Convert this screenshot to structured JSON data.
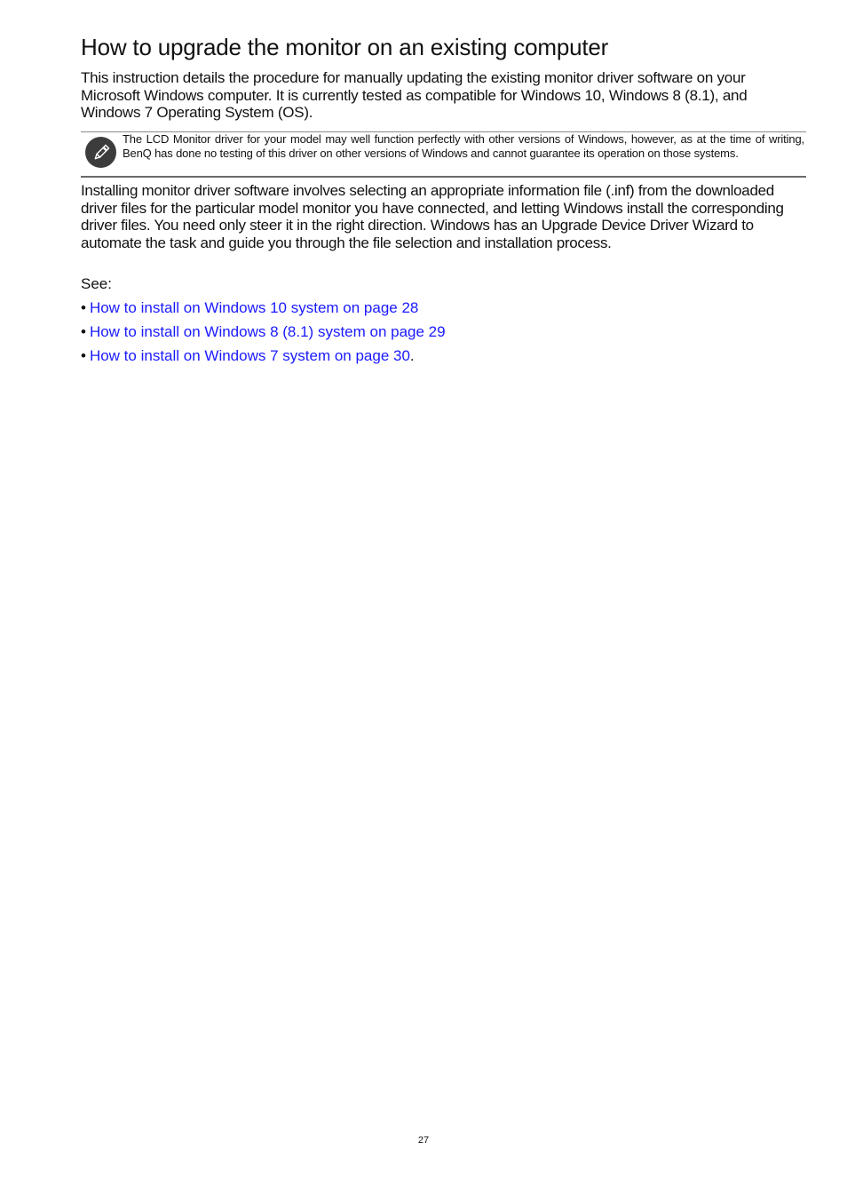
{
  "document": {
    "title": "How to upgrade the monitor on an existing computer",
    "intro": "This instruction details the procedure for manually updating the existing monitor driver software on your Microsoft Windows computer. It is currently tested as compatible for Windows 10, Windows 8 (8.1), and Windows 7 Operating System (OS).",
    "note": {
      "icon": "pencil-icon",
      "text": "The LCD Monitor driver for your model may well function perfectly with other versions of Windows, however, as at the time of writing, BenQ has done no testing of this driver on other versions of Windows and cannot guarantee its operation on those systems."
    },
    "body": "Installing monitor driver software involves selecting an appropriate information file (.inf) from the downloaded driver files for the particular model monitor you have connected, and letting Windows install the corresponding driver files. You need only steer it in the right direction. Windows has an Upgrade Device Driver Wizard to automate the task and guide you through the file selection and installation process.",
    "see_label": "See:",
    "links": [
      {
        "bullet": "•",
        "label": "How to install on Windows 10 system on page 28",
        "trail": ""
      },
      {
        "bullet": "•",
        "label": "How to install on Windows 8 (8.1) system on page 29",
        "trail": ""
      },
      {
        "bullet": "•",
        "label": "How to install on Windows 7 system on page 30",
        "trail": "."
      }
    ],
    "link_color": "#1a1aff",
    "page_number": "27"
  }
}
